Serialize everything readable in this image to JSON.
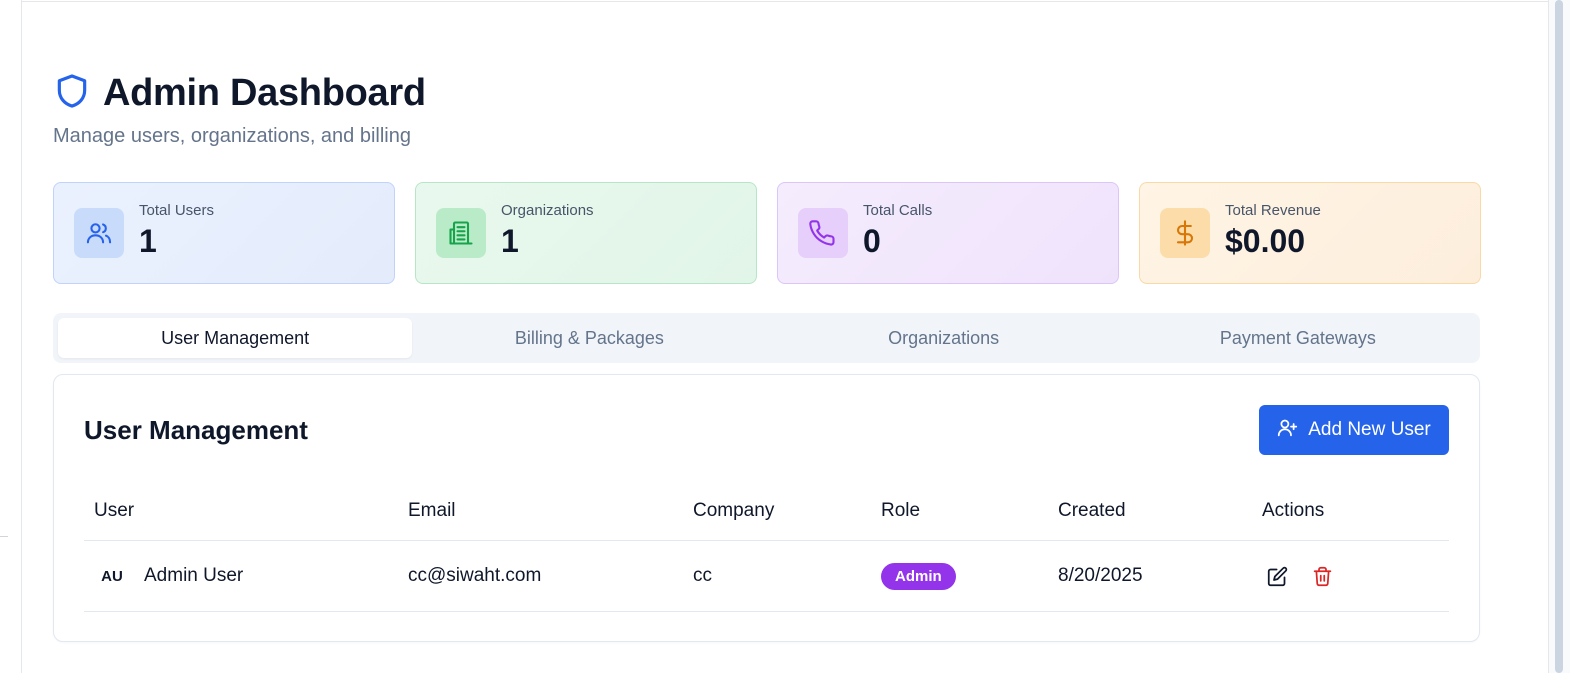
{
  "header": {
    "title": "Admin Dashboard",
    "subtitle": "Manage users, organizations, and billing",
    "icon": "shield-icon"
  },
  "stats": [
    {
      "label": "Total Users",
      "value": "1",
      "icon": "users-icon",
      "color": "#2563eb"
    },
    {
      "label": "Organizations",
      "value": "1",
      "icon": "building-icon",
      "color": "#16a34a"
    },
    {
      "label": "Total Calls",
      "value": "0",
      "icon": "phone-icon",
      "color": "#9333ea"
    },
    {
      "label": "Total Revenue",
      "value": "$0.00",
      "icon": "dollar-icon",
      "color": "#d97706"
    }
  ],
  "tabs": [
    {
      "label": "User Management",
      "active": true
    },
    {
      "label": "Billing & Packages",
      "active": false
    },
    {
      "label": "Organizations",
      "active": false
    },
    {
      "label": "Payment Gateways",
      "active": false
    }
  ],
  "panel": {
    "title": "User Management",
    "add_button_label": "Add New User",
    "add_button_color": "#2563eb"
  },
  "table": {
    "columns": [
      "User",
      "Email",
      "Company",
      "Role",
      "Created",
      "Actions"
    ],
    "rows": [
      {
        "initials": "AU",
        "name": "Admin User",
        "email": "cc@siwaht.com",
        "company": "cc",
        "role": "Admin",
        "role_color": "#9333ea",
        "created": "8/20/2025",
        "actions": [
          "edit-icon",
          "trash-icon"
        ]
      }
    ]
  }
}
